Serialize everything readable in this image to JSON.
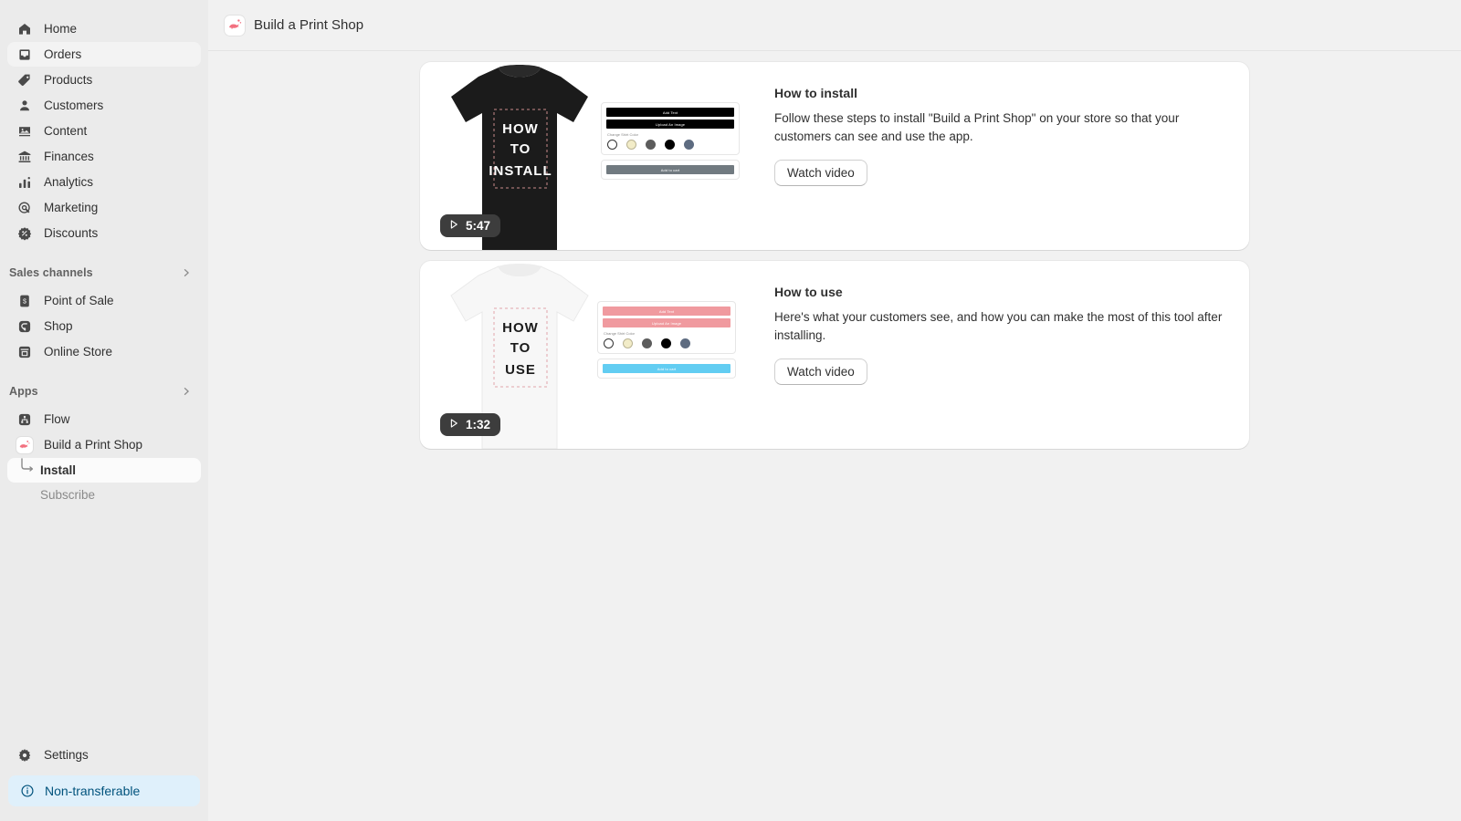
{
  "sidebar": {
    "primary": [
      {
        "label": "Home",
        "icon": "home-icon",
        "state": "normal"
      },
      {
        "label": "Orders",
        "icon": "orders-inbox-icon",
        "state": "active"
      },
      {
        "label": "Products",
        "icon": "products-tag-icon",
        "state": "normal"
      },
      {
        "label": "Customers",
        "icon": "customers-person-icon",
        "state": "normal"
      },
      {
        "label": "Content",
        "icon": "content-image-icon",
        "state": "normal"
      },
      {
        "label": "Finances",
        "icon": "finances-bank-icon",
        "state": "normal"
      },
      {
        "label": "Analytics",
        "icon": "analytics-bars-icon",
        "state": "normal"
      },
      {
        "label": "Marketing",
        "icon": "marketing-target-icon",
        "state": "normal"
      },
      {
        "label": "Discounts",
        "icon": "discounts-badge-icon",
        "state": "normal"
      }
    ],
    "sales_channels": {
      "title": "Sales channels",
      "items": [
        {
          "label": "Point of Sale",
          "icon": "point-of-sale-icon"
        },
        {
          "label": "Shop",
          "icon": "shop-icon"
        },
        {
          "label": "Online Store",
          "icon": "online-store-icon"
        }
      ]
    },
    "apps": {
      "title": "Apps",
      "items": [
        {
          "label": "Flow",
          "icon": "flow-icon"
        },
        {
          "label": "Build a Print Shop",
          "icon": "genie-lamp-app-icon"
        }
      ],
      "sub_items": [
        {
          "label": "Install",
          "state": "active"
        },
        {
          "label": "Subscribe",
          "state": "muted"
        }
      ]
    },
    "settings": {
      "label": "Settings",
      "icon": "gear-icon"
    },
    "status_badge": {
      "label": "Non-transferable",
      "icon": "info-circle-icon",
      "color": "#dff0fb",
      "text_color": "#00527c"
    }
  },
  "topbar": {
    "title": "Build a Print Shop",
    "icon": "genie-lamp-app-icon"
  },
  "cards": [
    {
      "title": "How to install",
      "body": "Follow these steps to install \"Build a Print Shop\" on your store so that your customers can see and use the app.",
      "button": "Watch video",
      "duration": "5:47",
      "play_icon": "play-triangle-icon",
      "thumbnail": {
        "shirt_color": "#1b1b1b",
        "shirt_text": [
          "HOW",
          "TO",
          "INSTALL"
        ],
        "shirt_text_color": "#ffffff",
        "buttons": [
          {
            "label": "Add Text",
            "color": "#000000"
          },
          {
            "label": "Upload An Image",
            "color": "#000000"
          }
        ],
        "swatch_label": "Change Shirt Color",
        "swatches": [
          "#ffffff",
          "#f2ecc8",
          "#5c5c5c",
          "#000000",
          "#5d6b80"
        ],
        "cart_button": {
          "label": "Add to cart",
          "color": "#717a80"
        }
      }
    },
    {
      "title": "How to use",
      "body": "Here's what your customers see, and how you can make the most of this tool after installing.",
      "button": "Watch video",
      "duration": "1:32",
      "play_icon": "play-triangle-icon",
      "thumbnail": {
        "shirt_color": "#f7f7f7",
        "shirt_text": [
          "HOW",
          "TO",
          "USE"
        ],
        "shirt_text_color": "#1b1b1b",
        "buttons": [
          {
            "label": "Add Text",
            "color": "#f09a9f"
          },
          {
            "label": "Upload An Image",
            "color": "#f09a9f"
          }
        ],
        "swatch_label": "Change Shirt Color",
        "swatches": [
          "#ffffff",
          "#f2ecc8",
          "#5c5c5c",
          "#000000",
          "#5d6b80"
        ],
        "cart_button": {
          "label": "Add to cart",
          "color": "#62cdf2"
        }
      }
    }
  ]
}
